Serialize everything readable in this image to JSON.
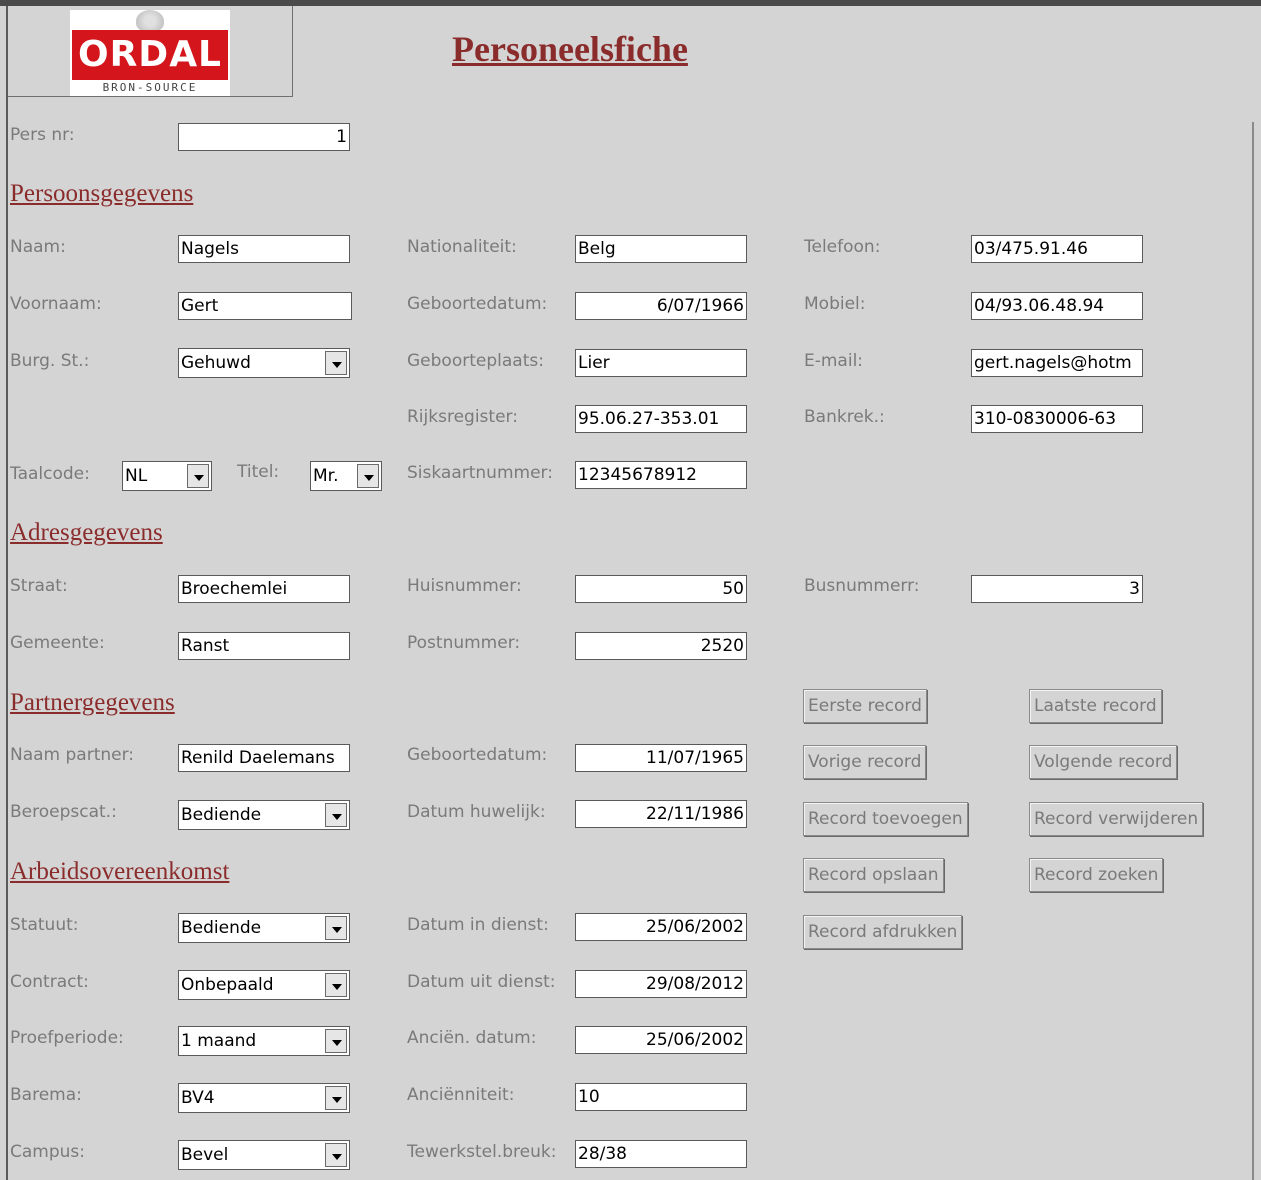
{
  "header": {
    "title": "Personeelsfiche",
    "logo_text": "ORDAL",
    "logo_sub": "BRON-SOURCE"
  },
  "pers_nr": {
    "label": "Pers nr:",
    "value": "1"
  },
  "sections": {
    "persoon": "Persoonsgegevens",
    "adres": "Adresgegevens",
    "partner": "Partnergegevens",
    "arbeid": "Arbeidsovereenkomst"
  },
  "persoon": {
    "naam": {
      "label": "Naam:",
      "value": "Nagels"
    },
    "voornaam": {
      "label": "Voornaam:",
      "value": "Gert"
    },
    "burg_st": {
      "label": "Burg. St.:",
      "value": "Gehuwd"
    },
    "taalcode": {
      "label": "Taalcode:",
      "value": "NL"
    },
    "titel": {
      "label": "Titel:",
      "value": "Mr."
    },
    "nationaliteit": {
      "label": "Nationaliteit:",
      "value": "Belg"
    },
    "geboortedatum": {
      "label": "Geboortedatum:",
      "value": "6/07/1966"
    },
    "geboorteplaats": {
      "label": "Geboorteplaats:",
      "value": "Lier"
    },
    "rijksregister": {
      "label": "Rijksregister:",
      "value": "95.06.27-353.01"
    },
    "siskaart": {
      "label": "Siskaartnummer:",
      "value": "12345678912"
    },
    "telefoon": {
      "label": "Telefoon:",
      "value": "03/475.91.46"
    },
    "mobiel": {
      "label": "Mobiel:",
      "value": "04/93.06.48.94"
    },
    "email": {
      "label": "E-mail:",
      "value": "gert.nagels@hotm"
    },
    "bankrek": {
      "label": "Bankrek.:",
      "value": "310-0830006-63"
    }
  },
  "adres": {
    "straat": {
      "label": "Straat:",
      "value": "Broechemlei"
    },
    "gemeente": {
      "label": "Gemeente:",
      "value": "Ranst"
    },
    "huisnummer": {
      "label": "Huisnummer:",
      "value": "50"
    },
    "postnummer": {
      "label": "Postnummer:",
      "value": "2520"
    },
    "busnummer": {
      "label": "Busnummerr:",
      "value": "3"
    }
  },
  "partner": {
    "naam": {
      "label": "Naam partner:",
      "value": "Renild Daelemans"
    },
    "beroepscat": {
      "label": "Beroepscat.:",
      "value": "Bediende"
    },
    "geboortedatum": {
      "label": "Geboortedatum:",
      "value": "11/07/1965"
    },
    "datum_huwelijk": {
      "label": "Datum huwelijk:",
      "value": "22/11/1986"
    }
  },
  "arbeid": {
    "statuut": {
      "label": "Statuut:",
      "value": "Bediende"
    },
    "contract": {
      "label": "Contract:",
      "value": "Onbepaald"
    },
    "proefperiode": {
      "label": "Proefperiode:",
      "value": "1 maand"
    },
    "barema": {
      "label": "Barema:",
      "value": "BV4"
    },
    "campus": {
      "label": "Campus:",
      "value": "Bevel"
    },
    "datum_in": {
      "label": "Datum in dienst:",
      "value": "25/06/2002"
    },
    "datum_uit": {
      "label": "Datum uit dienst:",
      "value": "29/08/2012"
    },
    "ancien_datum": {
      "label": "Anciën. datum:",
      "value": "25/06/2002"
    },
    "ancienniteit": {
      "label": "Anciënniteit:",
      "value": "10"
    },
    "tewerkstel": {
      "label": "Tewerkstel.breuk:",
      "value": "28/38"
    }
  },
  "buttons": {
    "eerste": "Eerste record",
    "laatste": "Laatste record",
    "vorige": "Vorige record",
    "volgende": "Volgende record",
    "toevoegen": "Record toevoegen",
    "verwijderen": "Record verwijderen",
    "opslaan": "Record opslaan",
    "zoeken": "Record zoeken",
    "afdrukken": "Record afdrukken"
  }
}
